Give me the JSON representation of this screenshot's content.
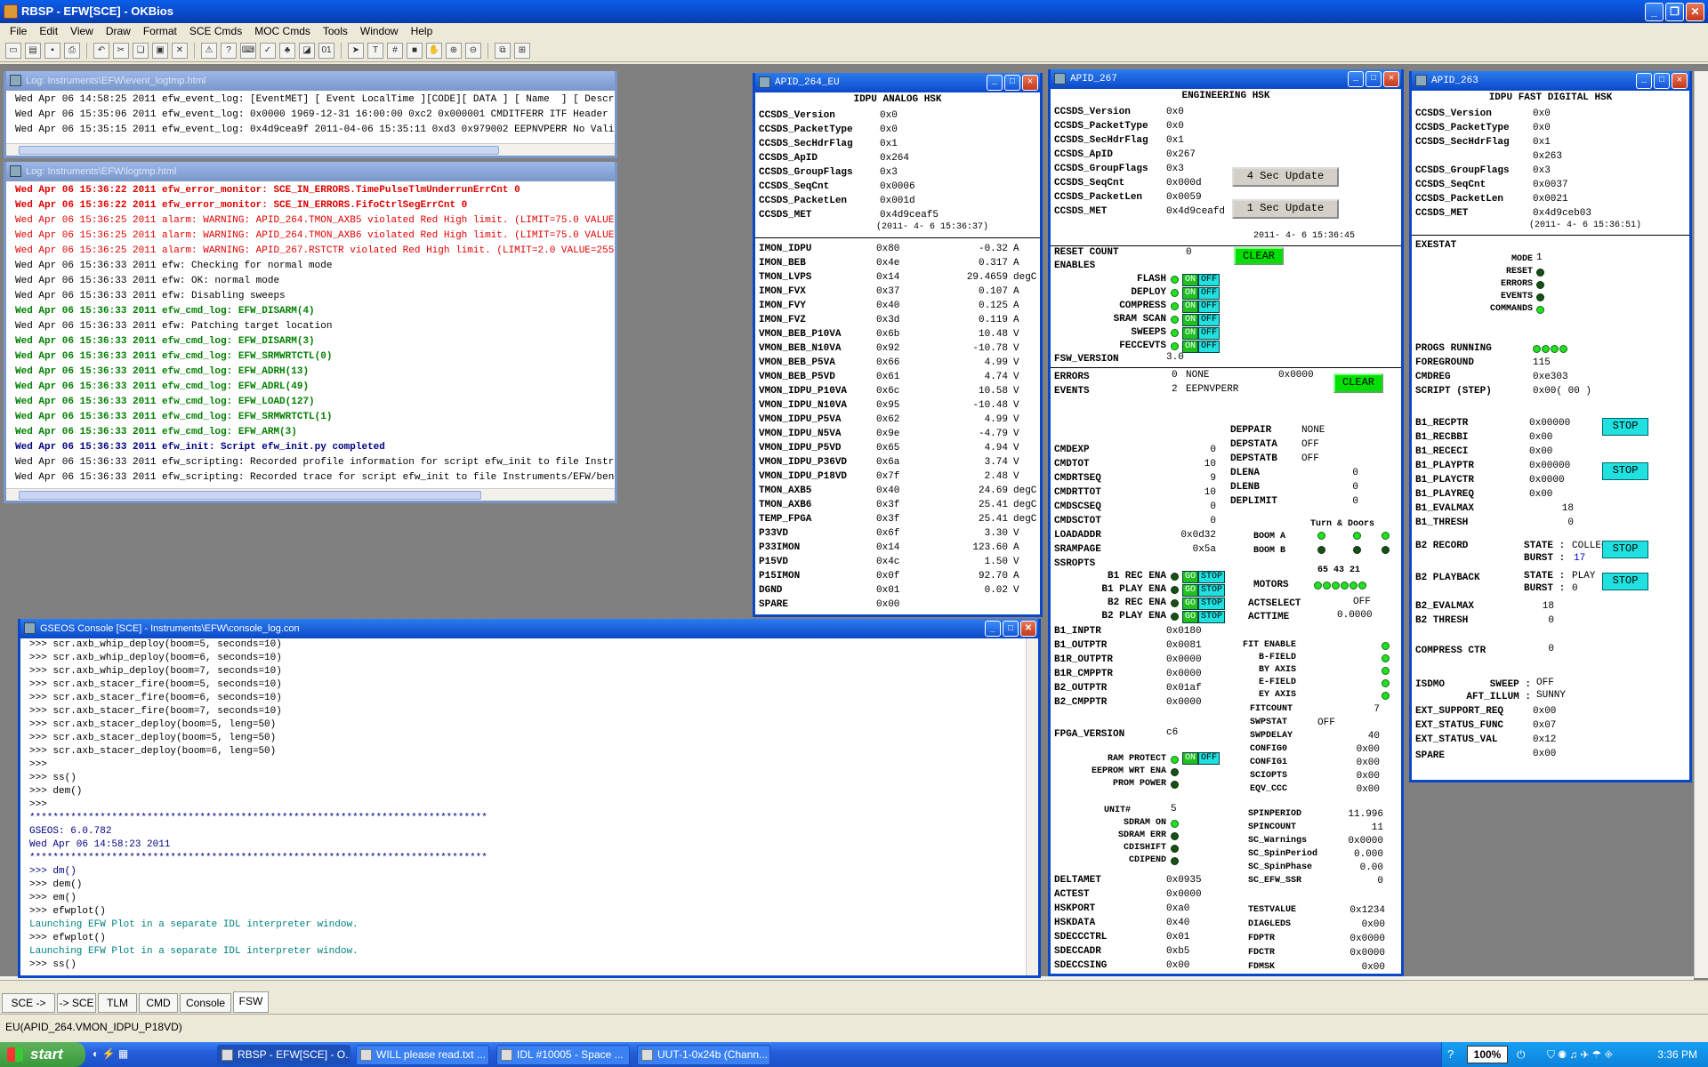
{
  "app": {
    "title": "RBSP - EFW[SCE] - OKBios"
  },
  "menu": [
    "File",
    "Edit",
    "View",
    "Draw",
    "Format",
    "SCE Cmds",
    "MOC Cmds",
    "Tools",
    "Window",
    "Help"
  ],
  "event_log": {
    "title": "Log: Instruments\\EFW\\event_logtmp.html",
    "lines": [
      "Wed Apr 06 14:58:25 2011 efw_event_log: [EventMET] [ Event LocalTime ][CODE][ DATA ] [ Name  ] [ Description ]",
      "Wed Apr 06 15:35:06 2011 efw_event_log: 0x0000 1969-12-31 16:00:00 0xc2 0x000001 CMDITFERR ITF Header Error",
      "Wed Apr 06 15:35:15 2011 efw_event_log: 0x4d9cea9f 2011-04-06 15:35:11 0xd3 0x979002 EEPNVPERR No Valid EEPROM"
    ]
  },
  "main_log": {
    "title": "Log: Instruments\\EFW\\logtmp.html",
    "lines": [
      {
        "c": "redb",
        "t": "Wed Apr 06 15:36:22 2011 efw_error_monitor: SCE_IN_ERRORS.TimePulseTlmUnderrunErrCnt 0"
      },
      {
        "c": "redb",
        "t": "Wed Apr 06 15:36:22 2011 efw_error_monitor: SCE_IN_ERRORS.FifoCtrlSegErrCnt 0"
      },
      {
        "c": "red",
        "t": "Wed Apr 06 15:36:25 2011 alarm: WARNING: APID_264.TMON_AXB5 violated Red High limit. (LIMIT=75.0 VALUE=0x40)"
      },
      {
        "c": "red",
        "t": "Wed Apr 06 15:36:25 2011 alarm: WARNING: APID_264.TMON_AXB6 violated Red High limit. (LIMIT=75.0 VALUE=0x3f)"
      },
      {
        "c": "red",
        "t": "Wed Apr 06 15:36:25 2011 alarm: WARNING: APID_267.RSTCTR violated Red High limit. (LIMIT=2.0 VALUE=255)"
      },
      {
        "c": "blk",
        "t": "Wed Apr 06 15:36:33 2011 efw: Checking for normal mode"
      },
      {
        "c": "blk",
        "t": "Wed Apr 06 15:36:33 2011 efw: OK: normal mode"
      },
      {
        "c": "blk",
        "t": "Wed Apr 06 15:36:33 2011 efw: Disabling sweeps"
      },
      {
        "c": "grn",
        "t": "Wed Apr 06 15:36:33 2011 efw_cmd_log: EFW_DISARM(4)"
      },
      {
        "c": "blk",
        "t": "Wed Apr 06 15:36:33 2011 efw: Patching target location"
      },
      {
        "c": "grn",
        "t": "Wed Apr 06 15:36:33 2011 efw_cmd_log: EFW_DISARM(3)"
      },
      {
        "c": "grn",
        "t": "Wed Apr 06 15:36:33 2011 efw_cmd_log: EFW_SRMWRTCTL(0)"
      },
      {
        "c": "grn",
        "t": "Wed Apr 06 15:36:33 2011 efw_cmd_log: EFW_ADRH(13)"
      },
      {
        "c": "grn",
        "t": "Wed Apr 06 15:36:33 2011 efw_cmd_log: EFW_ADRL(49)"
      },
      {
        "c": "grn",
        "t": "Wed Apr 06 15:36:33 2011 efw_cmd_log: EFW_LOAD(127)"
      },
      {
        "c": "grn",
        "t": "Wed Apr 06 15:36:33 2011 efw_cmd_log: EFW_SRMWRTCTL(1)"
      },
      {
        "c": "grn",
        "t": "Wed Apr 06 15:36:33 2011 efw_cmd_log: EFW_ARM(3)"
      },
      {
        "c": "blu",
        "t": "Wed Apr 06 15:36:33 2011 efw_init: Script efw_init.py completed"
      },
      {
        "c": "blk",
        "t": "Wed Apr 06 15:36:33 2011 efw_scripting: Recorded profile information for script efw_init to file Instruments/EFW/"
      },
      {
        "c": "blk",
        "t": "Wed Apr 06 15:36:33 2011 efw_scripting: Recorded trace for script efw_init to file Instruments/EFW/bench/"
      }
    ]
  },
  "console": {
    "title": "GSEOS Console  [SCE] - Instruments\\EFW\\console_log.con",
    "lines": [
      {
        "c": "blk",
        "t": ">>> scr.axb_whip_deploy(boom=5, seconds=10)"
      },
      {
        "c": "blk",
        "t": ">>> scr.axb_whip_deploy(boom=6, seconds=10)"
      },
      {
        "c": "blk",
        "t": ">>> scr.axb_whip_deploy(boom=7, seconds=10)"
      },
      {
        "c": "blk",
        "t": ">>> scr.axb_stacer_fire(boom=5, seconds=10)"
      },
      {
        "c": "blk",
        "t": ">>> scr.axb_stacer_fire(boom=6, seconds=10)"
      },
      {
        "c": "blk",
        "t": ">>> scr.axb_stacer_fire(boom=7, seconds=10)"
      },
      {
        "c": "blk",
        "t": ">>> scr.axb_stacer_deploy(boom=5, leng=50)"
      },
      {
        "c": "blk",
        "t": ">>> scr.axb_stacer_deploy(boom=5, leng=50)"
      },
      {
        "c": "blk",
        "t": ">>> scr.axb_stacer_deploy(boom=6, leng=50)"
      },
      {
        "c": "blk",
        "t": ">>>"
      },
      {
        "c": "blk",
        "t": ">>> ss()"
      },
      {
        "c": "blk",
        "t": ">>> dem()"
      },
      {
        "c": "blk",
        "t": ">>>"
      },
      {
        "c": "nv",
        "t": "******************************************************************************"
      },
      {
        "c": "nv",
        "t": "GSEOS: 6.0.782"
      },
      {
        "c": "nv",
        "t": "Wed Apr 06 14:58:23 2011"
      },
      {
        "c": "nv",
        "t": "******************************************************************************"
      },
      {
        "c": "nv",
        "t": ">>> dm()"
      },
      {
        "c": "blk",
        "t": ">>> dem()"
      },
      {
        "c": "blk",
        "t": ">>> em()"
      },
      {
        "c": "blk",
        "t": ">>> efwplot()"
      },
      {
        "c": "tl",
        "t": "Launching EFW Plot in a separate IDL interpreter window."
      },
      {
        "c": "blk",
        "t": ">>> efwplot()"
      },
      {
        "c": "tl",
        "t": "Launching EFW Plot in a separate IDL interpreter window."
      },
      {
        "c": "blk",
        "t": ">>> ss()"
      }
    ]
  },
  "apid264": {
    "title": "APID_264_EU",
    "heading": "IDPU ANALOG HSK",
    "hdr": [
      [
        "CCSDS_Version",
        "0x0"
      ],
      [
        "CCSDS_PacketType",
        "0x0"
      ],
      [
        "CCSDS_SecHdrFlag",
        "0x1"
      ],
      [
        "CCSDS_ApID",
        "0x264"
      ],
      [
        "CCSDS_GroupFlags",
        "0x3"
      ],
      [
        "CCSDS_SeqCnt",
        "0x0006"
      ],
      [
        "CCSDS_PacketLen",
        "0x001d"
      ],
      [
        "CCSDS_MET",
        "0x4d9ceaf5"
      ]
    ],
    "met_time": "(2011- 4- 6  15:36:37)",
    "rows": [
      [
        "IMON_IDPU",
        "0x80",
        "-0.32",
        "A"
      ],
      [
        "IMON_BEB",
        "0x4e",
        "0.317",
        "A"
      ],
      [
        "TMON_LVPS",
        "0x14",
        "29.4659",
        "degC"
      ],
      [
        "IMON_FVX",
        "0x37",
        "0.107",
        "A"
      ],
      [
        "IMON_FVY",
        "0x40",
        "0.125",
        "A"
      ],
      [
        "IMON_FVZ",
        "0x3d",
        "0.119",
        "A"
      ],
      [
        "VMON_BEB_P10VA",
        "0x6b",
        "10.48",
        "V"
      ],
      [
        "VMON_BEB_N10VA",
        "0x92",
        "-10.78",
        "V"
      ],
      [
        "VMON_BEB_P5VA",
        "0x66",
        "4.99",
        "V"
      ],
      [
        "VMON_BEB_P5VD",
        "0x61",
        "4.74",
        "V"
      ],
      [
        "VMON_IDPU_P10VA",
        "0x6c",
        "10.58",
        "V"
      ],
      [
        "VMON_IDPU_N10VA",
        "0x95",
        "-10.48",
        "V"
      ],
      [
        "VMON_IDPU_P5VA",
        "0x62",
        "4.99",
        "V"
      ],
      [
        "VMON_IDPU_N5VA",
        "0x9e",
        "-4.79",
        "V"
      ],
      [
        "VMON_IDPU_P5VD",
        "0x65",
        "4.94",
        "V"
      ],
      [
        "VMON_IDPU_P36VD",
        "0x6a",
        "3.74",
        "V"
      ],
      [
        "VMON_IDPU_P18VD",
        "0x7f",
        "2.48",
        "V"
      ],
      [
        "TMON_AXB5",
        "0x40",
        "24.69",
        "degC"
      ],
      [
        "TMON_AXB6",
        "0x3f",
        "25.41",
        "degC"
      ],
      [
        "TEMP_FPGA",
        "0x3f",
        "25.41",
        "degC"
      ],
      [
        "P33VD",
        "0x6f",
        "3.30",
        "V"
      ],
      [
        "P33IMON",
        "0x14",
        "123.60",
        "A"
      ],
      [
        "P15VD",
        "0x4c",
        "1.50",
        "V"
      ],
      [
        "P15IMON",
        "0x0f",
        "92.70",
        "A"
      ],
      [
        "DGND",
        "0x01",
        "0.02",
        "V"
      ],
      [
        "SPARE",
        "0x00",
        "",
        ""
      ]
    ]
  },
  "apid267": {
    "title": "APID_267",
    "heading": "ENGINEERING HSK",
    "hdr": [
      [
        "CCSDS_Version",
        "0x0"
      ],
      [
        "CCSDS_PacketType",
        "0x0"
      ],
      [
        "CCSDS_SecHdrFlag",
        "0x1"
      ],
      [
        "CCSDS_ApID",
        "0x267"
      ],
      [
        "CCSDS_GroupFlags",
        "0x3"
      ],
      [
        "CCSDS_SeqCnt",
        "0x000d"
      ],
      [
        "CCSDS_PacketLen",
        "0x0059"
      ],
      [
        "CCSDS_MET",
        "0x4d9ceafd"
      ]
    ],
    "btn4": "4 Sec Update",
    "btn1": "1 Sec Update",
    "met_time": "2011- 4- 6  15:36:45",
    "reset_label": "RESET COUNT",
    "reset_val": "0",
    "clear": "CLEAR",
    "enables": "ENABLES",
    "en": [
      "FLASH",
      "DEPLOY",
      "COMPRESS",
      "SRAM SCAN",
      "SWEEPS",
      "FECCEVTS"
    ],
    "on": "ON",
    "off": "OFF",
    "fsw_label": "FSW_VERSION",
    "fsw": "3.0",
    "errors": [
      "ERRORS",
      "0",
      "NONE",
      "0x0000"
    ],
    "events": [
      "EVENTS",
      "2",
      "EEPNVPERR"
    ],
    "left": [
      [
        "CMDEXP",
        "0"
      ],
      [
        "CMDTOT",
        "10"
      ],
      [
        "CMDRTSEQ",
        "9"
      ],
      [
        "CMDRTTOT",
        "10"
      ],
      [
        "CMDSCSEQ",
        "0"
      ],
      [
        "CMDSCTOT",
        "0"
      ],
      [
        "LOADADDR",
        "0x0d32"
      ],
      [
        "SRAMPAGE",
        "0x5a"
      ]
    ],
    "right": [
      [
        "DEPPAIR",
        "NONE"
      ],
      [
        "DEPSTATA",
        "OFF"
      ],
      [
        "DEPSTATB",
        "OFF"
      ],
      [
        "DLENA",
        "0"
      ],
      [
        "DLENB",
        "0"
      ],
      [
        "DEPLIMIT",
        "0"
      ]
    ],
    "turn": "Turn & Doors",
    "booma": "BOOM A",
    "boomb": "BOOM B",
    "ssropts": "SSROPTS",
    "rec": [
      "B1 REC ENA",
      "B1 PLAY ENA",
      "B2 REC ENA",
      "B2 PLAY ENA"
    ],
    "go": "GO",
    "stop": "STOP",
    "motors": "MOTORS",
    "motnums": "65 43 21",
    "actsel": [
      "ACTSELECT",
      "OFF"
    ],
    "acttime": [
      "ACTTIME",
      "0.0000"
    ],
    "ptrs": [
      [
        "B1_INPTR",
        "0x0180"
      ],
      [
        "B1_OUTPTR",
        "0x0081"
      ],
      [
        "B1R_OUTPTR",
        "0x0000"
      ],
      [
        "B1R_CMPPTR",
        "0x0000"
      ],
      [
        "B2_OUTPTR",
        "0x01af"
      ],
      [
        "B2_CMPPTR",
        "0x0000"
      ]
    ],
    "fit": [
      "FIT ENABLE",
      "B-FIELD",
      "BY AXIS",
      "E-FIELD",
      "EY AXIS"
    ],
    "fitr": [
      [
        "FITCOUNT",
        "7"
      ],
      [
        "SWPSTAT",
        "OFF"
      ],
      [
        "SWPDELAY",
        "40"
      ],
      [
        "CONFIG0",
        "0x00"
      ],
      [
        "CONFIG1",
        "0x00"
      ],
      [
        "SCIOPTS",
        "0x00"
      ],
      [
        "EQV_CCC",
        "0x00"
      ]
    ],
    "fpga": [
      "FPGA_VERSION",
      "c6"
    ],
    "prot": [
      "RAM PROTECT",
      "EEPROM WRT ENA",
      "PROM POWER"
    ],
    "unit": [
      "UNIT#",
      "5"
    ],
    "sdram": [
      "SDRAM ON",
      "SDRAM ERR",
      "CDISHIFT",
      "CDIPEND"
    ],
    "spin": [
      [
        "SPINPERIOD",
        "11.996"
      ],
      [
        "SPINCOUNT",
        "11"
      ],
      [
        "SC_Warnings",
        "0x0000"
      ],
      [
        "SC_SpinPeriod",
        "0.000"
      ],
      [
        "SC_SpinPhase",
        "0.00"
      ],
      [
        "SC_EFW_SSR",
        "0"
      ]
    ],
    "bot": [
      [
        "DELTAMET",
        "0x0935"
      ],
      [
        "ACTEST",
        "0x0000"
      ],
      [
        "HSKPORT",
        "0xa0"
      ],
      [
        "HSKDATA",
        "0x40"
      ],
      [
        "SDECCCTRL",
        "0x01"
      ],
      [
        "SDECCADR",
        "0xb5"
      ],
      [
        "SDECCSING",
        "0x00"
      ],
      [
        "SDECCMULT",
        "0x00"
      ]
    ],
    "botr": [
      [
        "TESTVALUE",
        "0x1234"
      ],
      [
        "DIAGLEDS",
        "0x00"
      ],
      [
        "FDPTR",
        "0x0000"
      ],
      [
        "FDCTR",
        "0x0000"
      ],
      [
        "FDMSK",
        "0x00"
      ]
    ]
  },
  "apid263": {
    "title": "APID_263",
    "heading": "IDPU FAST DIGITAL HSK",
    "hdr": [
      [
        "CCSDS_Version",
        "0x0"
      ],
      [
        "CCSDS_PacketType",
        "0x0"
      ],
      [
        "CCSDS_SecHdrFlag",
        "0x1"
      ],
      [
        "",
        "0x263"
      ],
      [
        "CCSDS_GroupFlags",
        "0x3"
      ],
      [
        "CCSDS_SeqCnt",
        "0x0037"
      ],
      [
        "CCSDS_PacketLen",
        "0x0021"
      ],
      [
        "CCSDS_MET",
        "0x4d9ceb03"
      ]
    ],
    "met_time": "(2011- 4- 6  15:36:51)",
    "exestat": "EXESTAT",
    "mode": [
      "MODE",
      "1"
    ],
    "stat": [
      "RESET",
      "ERRORS",
      "EVENTS",
      "COMMANDS"
    ],
    "r1": [
      [
        "PROGS RUNNING",
        ""
      ],
      [
        "FOREGROUND",
        "115"
      ],
      [
        "CMDREG",
        "0xe303"
      ],
      [
        "SCRIPT (STEP)",
        "0x00( 00 )"
      ]
    ],
    "r2": [
      [
        "B1_RECPTR",
        "0x00000"
      ],
      [
        "B1_RECBBI",
        "0x00"
      ],
      [
        "B1_RECECI",
        "0x00"
      ],
      [
        "B1_PLAYPTR",
        "0x00000"
      ],
      [
        "B1_PLAYCTR",
        "0x0000"
      ],
      [
        "B1_PLAYREQ",
        "0x00"
      ],
      [
        "B1_EVALMAX",
        "18"
      ],
      [
        "B1_THRESH",
        "0"
      ]
    ],
    "stop": "STOP",
    "b2rec": [
      "B2 RECORD",
      "STATE :",
      "COLLECT",
      "BURST :",
      "17"
    ],
    "b2play": [
      "B2 PLAYBACK",
      "STATE :",
      "PLAY",
      "BURST :",
      "0"
    ],
    "b2e": [
      [
        "B2_EVALMAX",
        "18"
      ],
      [
        "B2 THRESH",
        "0"
      ]
    ],
    "comp": [
      "COMPRESS CTR",
      "0"
    ],
    "isdmo": [
      "ISDMO",
      "SWEEP :",
      "OFF",
      "AFT_ILLUM :",
      "SUNNY"
    ],
    "ext": [
      [
        "EXT_SUPPORT_REQ",
        "0x00"
      ],
      [
        "EXT_STATUS_FUNC",
        "0x07"
      ],
      [
        "EXT_STATUS_VAL",
        "0x12"
      ]
    ],
    "spare": [
      "SPARE",
      "0x00"
    ]
  },
  "tabs": [
    "SCE ->",
    "-> SCE",
    "TLM",
    "CMD",
    "Console",
    "FSW"
  ],
  "status": "EU(APID_264.VMON_IDPU_P18VD)",
  "taskbar": {
    "start": "start",
    "tasks": [
      "RBSP - EFW[SCE] - O...",
      "WILL please read.txt ...",
      "IDL #10005 - Space ...",
      "UUT-1-0x24b (Chann..."
    ],
    "zoom": "100%",
    "clock": "3:36 PM"
  }
}
